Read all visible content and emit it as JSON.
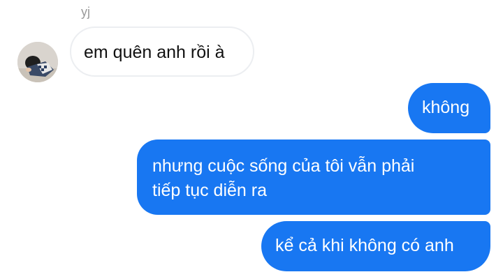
{
  "conversation": {
    "sender_name": "yj",
    "avatar_icon": "contact-avatar-photo",
    "colors": {
      "outgoing_bubble": "#1877f2",
      "incoming_bubble": "#ffffff",
      "incoming_border": "#eceef1",
      "sender_name": "#9a9a9a"
    },
    "messages": [
      {
        "direction": "incoming",
        "lines": [
          "em quên anh rồi à"
        ]
      },
      {
        "direction": "outgoing",
        "lines": [
          "không"
        ]
      },
      {
        "direction": "outgoing",
        "lines": [
          "nhưng cuộc sống của tôi vẫn phải",
          "tiếp tục diễn ra"
        ]
      },
      {
        "direction": "outgoing",
        "lines": [
          "kể cả khi không có anh"
        ]
      }
    ]
  }
}
